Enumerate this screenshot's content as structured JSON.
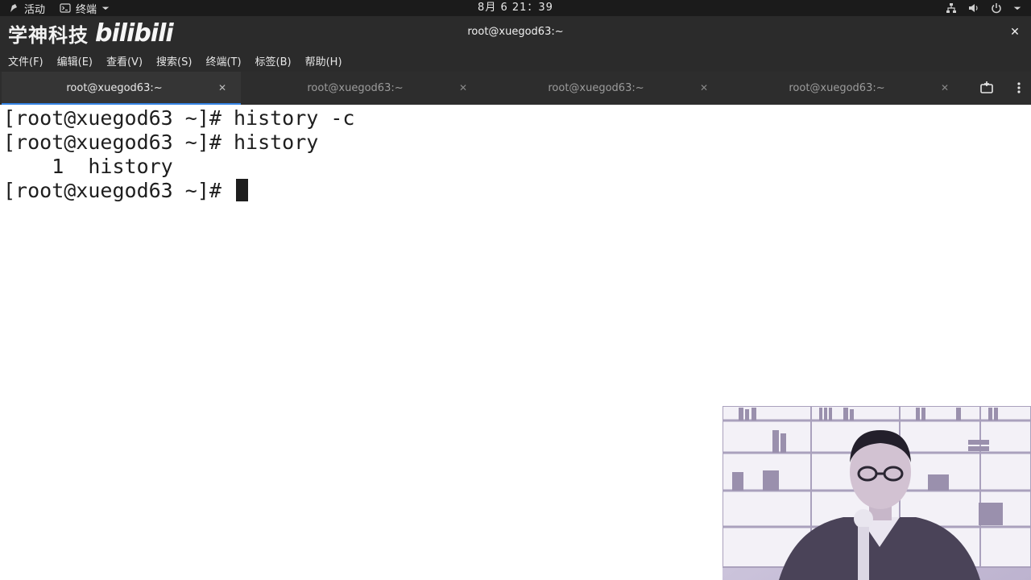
{
  "topbar": {
    "activities": "活动",
    "app_menu": "终端",
    "clock": "8月 6 21：39"
  },
  "window": {
    "title": "root@xuegod63:~",
    "watermark_brand": "学神科技",
    "watermark_site": "bilibili"
  },
  "menubar": {
    "items": [
      "文件(F)",
      "编辑(E)",
      "查看(V)",
      "搜索(S)",
      "终端(T)",
      "标签(B)",
      "帮助(H)"
    ]
  },
  "tabs": [
    {
      "label": "root@xuegod63:~",
      "active": true
    },
    {
      "label": "root@xuegod63:~",
      "active": false
    },
    {
      "label": "root@xuegod63:~",
      "active": false
    },
    {
      "label": "root@xuegod63:~",
      "active": false
    }
  ],
  "terminal": {
    "lines": [
      "[root@xuegod63 ~]# history -c",
      "[root@xuegod63 ~]# history",
      "    1  history",
      "[root@xuegod63 ~]# "
    ]
  },
  "colors": {
    "topbar_bg": "#1b1b1b",
    "chrome_bg": "#2b2b2b",
    "accent": "#3584e4",
    "terminal_bg": "#ffffff",
    "terminal_fg": "#1e1e1e"
  }
}
